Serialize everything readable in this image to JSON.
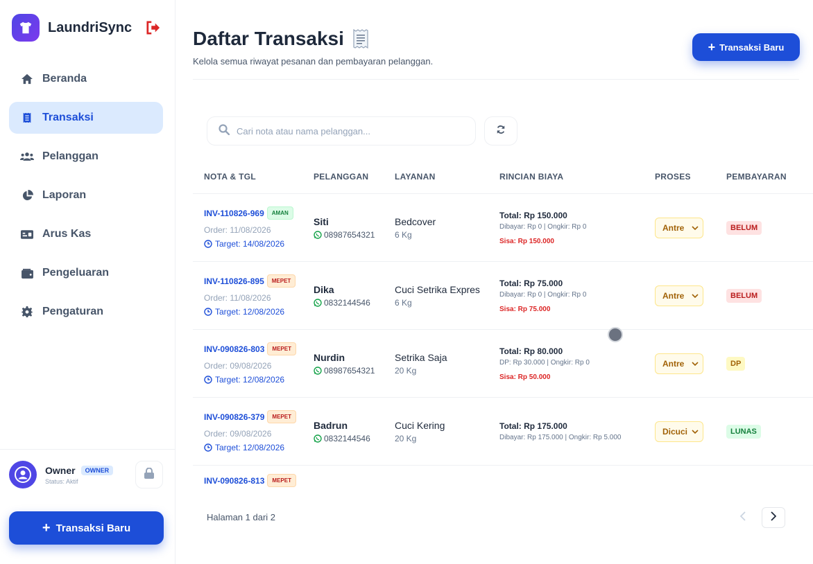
{
  "brand": {
    "name": "LaundriSync"
  },
  "nav": [
    {
      "label": "Beranda",
      "icon": "home-icon"
    },
    {
      "label": "Transaksi",
      "icon": "receipt-icon",
      "active": true
    },
    {
      "label": "Pelanggan",
      "icon": "users-icon"
    },
    {
      "label": "Laporan",
      "icon": "pie-chart-icon"
    },
    {
      "label": "Arus Kas",
      "icon": "money-icon"
    },
    {
      "label": "Pengeluaran",
      "icon": "wallet-icon"
    },
    {
      "label": "Pengaturan",
      "icon": "gear-icon"
    }
  ],
  "user": {
    "name": "Owner",
    "role": "OWNER",
    "status": "Status: Aktif"
  },
  "sidebar_button": {
    "label": "Transaksi Baru"
  },
  "header": {
    "title": "Daftar Transaksi",
    "subtitle": "Kelola semua riwayat pesanan dan pembayaran pelanggan.",
    "new_button": "Transaksi Baru"
  },
  "search": {
    "placeholder": "Cari nota atau nama pelanggan..."
  },
  "table": {
    "columns": [
      "NOTA & TGL",
      "PELANGGAN",
      "LAYANAN",
      "RINCIAN BIAYA",
      "PROSES",
      "PEMBAYARAN"
    ],
    "rows": [
      {
        "invoice": "INV-110826-969",
        "urgency": "AMAN",
        "order": "Order: 11/08/2026",
        "target": "Target: 14/08/2026",
        "customer": "Siti",
        "phone": "08987654321",
        "service": "Bedcover",
        "qty": "6 Kg",
        "total": "Total: Rp 150.000",
        "paid": "Dibayar: Rp 0 | Ongkir: Rp 0",
        "sisa": "Sisa: Rp 150.000",
        "process": "Antre",
        "payment": "BELUM"
      },
      {
        "invoice": "INV-110826-895",
        "urgency": "MEPET",
        "order": "Order: 11/08/2026",
        "target": "Target: 12/08/2026",
        "customer": "Dika",
        "phone": "0832144546",
        "service": "Cuci Setrika Expres",
        "qty": "6 Kg",
        "total": "Total: Rp 75.000",
        "paid": "Dibayar: Rp 0 | Ongkir: Rp 0",
        "sisa": "Sisa: Rp 75.000",
        "process": "Antre",
        "payment": "BELUM"
      },
      {
        "invoice": "INV-090826-803",
        "urgency": "MEPET",
        "order": "Order: 09/08/2026",
        "target": "Target: 12/08/2026",
        "customer": "Nurdin",
        "phone": "08987654321",
        "service": "Setrika Saja",
        "qty": "20 Kg",
        "total": "Total: Rp 80.000",
        "paid": "DP: Rp 30.000 | Ongkir: Rp 0",
        "sisa": "Sisa: Rp 50.000",
        "process": "Antre",
        "payment": "DP"
      },
      {
        "invoice": "INV-090826-379",
        "urgency": "MEPET",
        "order": "Order: 09/08/2026",
        "target": "Target: 12/08/2026",
        "customer": "Badrun",
        "phone": "0832144546",
        "service": "Cuci Kering",
        "qty": "20 Kg",
        "total": "Total: Rp 175.000",
        "paid": "Dibayar: Rp 175.000 | Ongkir: Rp 5.000",
        "sisa": "",
        "process": "Dicuci",
        "payment": "LUNAS"
      },
      {
        "invoice": "INV-090826-813",
        "urgency": "MEPET",
        "order": "",
        "target": "",
        "customer": "",
        "phone": "",
        "service": "",
        "qty": "",
        "total": "",
        "paid": "",
        "sisa": "",
        "process": "",
        "payment": ""
      }
    ]
  },
  "pagination": {
    "label": "Halaman 1 dari 2"
  },
  "colors": {
    "primary": "#1d4ed8",
    "active_nav_bg": "#dbeafe",
    "danger": "#dc2626",
    "success": "#15803d",
    "warning": "#a16207"
  }
}
